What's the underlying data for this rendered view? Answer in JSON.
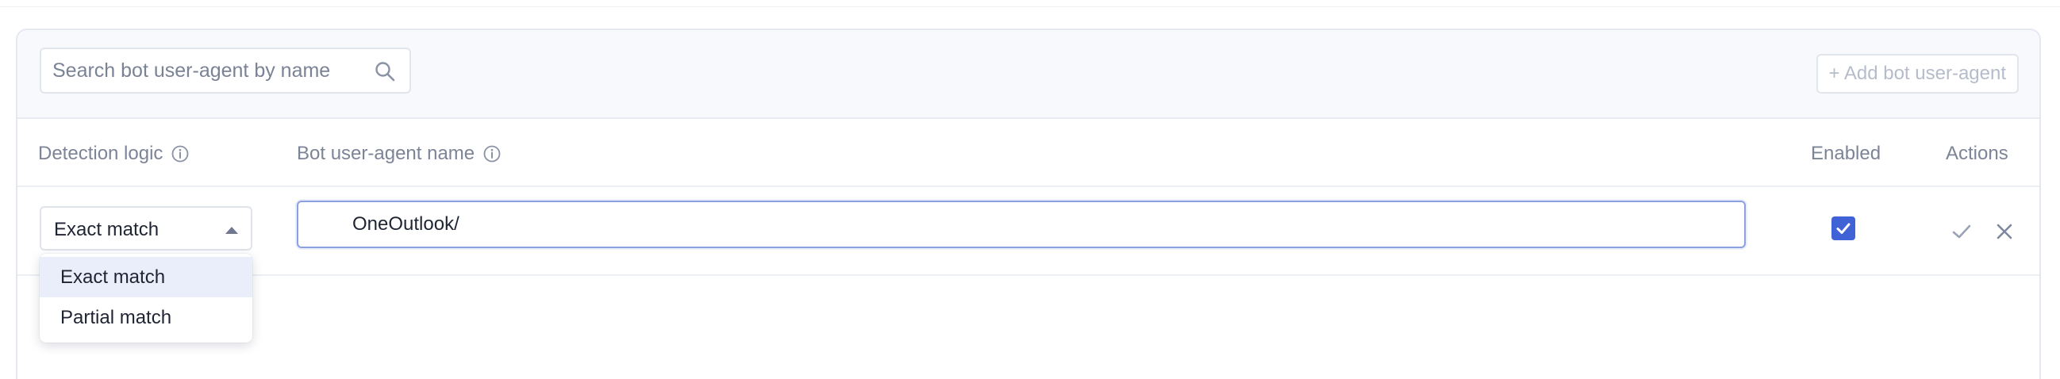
{
  "search": {
    "placeholder": "Search bot user-agent by name",
    "icon": "search-icon"
  },
  "toolbar": {
    "add_label": "+ Add bot user-agent"
  },
  "table": {
    "columns": {
      "detection_logic": "Detection logic",
      "bot_name": "Bot user-agent name",
      "enabled": "Enabled",
      "actions": "Actions"
    },
    "edit_row": {
      "detection_logic": "Exact match",
      "bot_name": "OneOutlook/",
      "enabled": true
    }
  },
  "dropdown": {
    "options": [
      "Exact match",
      "Partial match"
    ],
    "selected": "Exact match"
  },
  "colors": {
    "accent": "#3f62d6",
    "muted_text": "#7c8497",
    "border": "#e4e8f0"
  }
}
